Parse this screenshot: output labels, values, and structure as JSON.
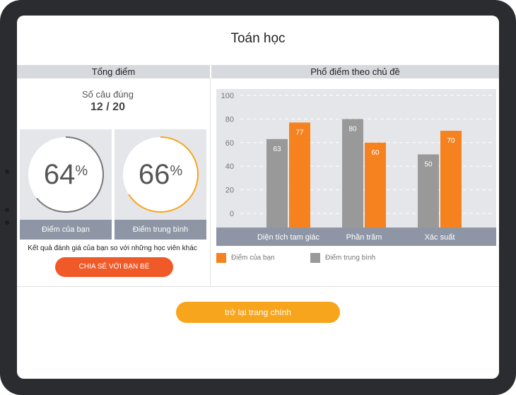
{
  "page": {
    "title": "Toán học"
  },
  "summary": {
    "header": "Tổng điểm",
    "correct_label": "Số câu đúng",
    "correct_value": "12 / 20",
    "your_score": {
      "percent": "64",
      "symbol": "%",
      "label": "Điểm của bạn",
      "ring_color": "#777777"
    },
    "average_score": {
      "percent": "66",
      "symbol": "%",
      "label": "Điểm trung bình",
      "ring_color": "#f7a51c"
    },
    "compare_text": "Kết quả đánh giá của bạn so với những học viên khác",
    "share_button": "CHIA SẺ VỚI BẠN BÈ"
  },
  "distribution": {
    "header": "Phổ điểm theo chủ đề",
    "legend": {
      "you": "Điểm của bạn",
      "avg": "Điểm trung bình"
    }
  },
  "back_button": "trở lại trang chính",
  "colors": {
    "you": "#f5821f",
    "avg": "#999999",
    "share": "#f05a28",
    "back": "#f7a51c"
  },
  "chart_data": {
    "type": "bar",
    "categories": [
      "Diện tích tam giác",
      "Phần trăm",
      "Xác suất"
    ],
    "series": [
      {
        "name": "Điểm trung bình",
        "values": [
          63,
          80,
          50
        ]
      },
      {
        "name": "Điểm của bạn",
        "values": [
          77,
          60,
          70
        ]
      }
    ],
    "y_ticks": [
      0,
      20,
      40,
      60,
      80,
      100
    ],
    "ylim": [
      0,
      100
    ],
    "grid": true,
    "legend": "bottom"
  }
}
